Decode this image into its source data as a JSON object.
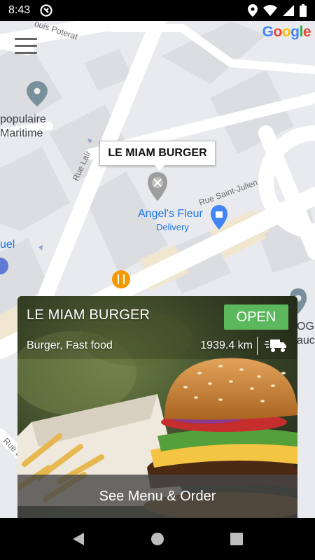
{
  "status_bar": {
    "time": "8:43"
  },
  "map": {
    "google_logo": [
      "G",
      "o",
      "o",
      "g",
      "l",
      "e"
    ],
    "google_colors": [
      "#4285F4",
      "#EA4335",
      "#FBBC05",
      "#4285F4",
      "#34A853",
      "#EA4335"
    ],
    "streets": {
      "poterat": "ouis Poterat",
      "lair": "Rue Lair",
      "saint_julien": "Rue Saint-Julien",
      "rue_left": "Rue L"
    },
    "places": {
      "populaire_line1": "populaire",
      "populaire_line2": "Maritime",
      "uel": "uel",
      "og_line1": "OG",
      "og_line2": "auc"
    },
    "poi": {
      "angels_fleur": "Angel's Fleur",
      "delivery": "Delivery"
    },
    "callout": "LE MIAM BURGER"
  },
  "card": {
    "title": "LE MIAM BURGER",
    "status": "OPEN",
    "cuisine": "Burger, Fast food",
    "distance": "1939.4 km",
    "cta": "See Menu & Order",
    "status_color": "#5cb85c"
  }
}
